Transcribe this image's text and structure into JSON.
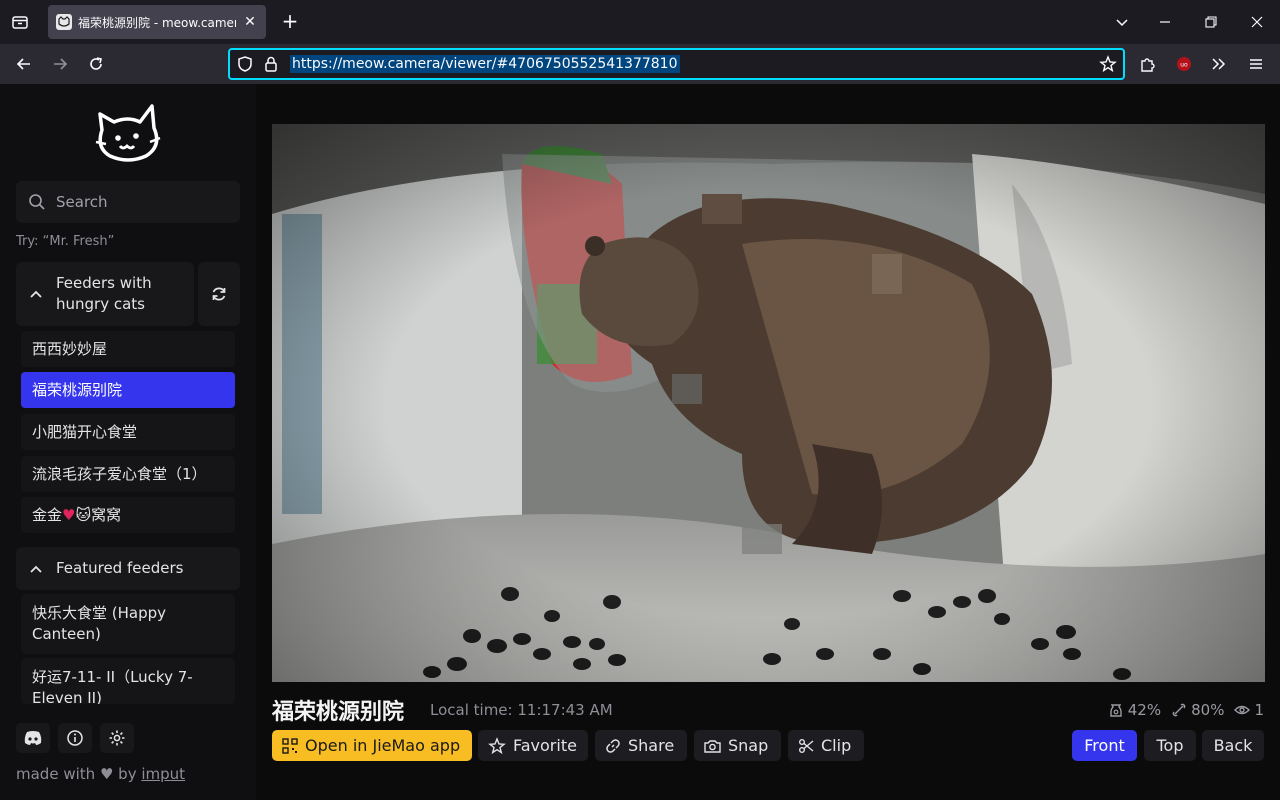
{
  "browser": {
    "tab_title": "福荣桃源别院 - meow.camera",
    "url": "https://meow.camera/viewer/#4706750552541377810"
  },
  "sidebar": {
    "search_placeholder": "Search",
    "hint": "Try: “Mr. Fresh”",
    "hungry_section": {
      "title": "Feeders with hungry cats",
      "items": [
        {
          "label": "西西妙妙屋"
        },
        {
          "label": "福荣桃源别院"
        },
        {
          "label": "小肥猫开心食堂"
        },
        {
          "label": "流浪毛孩子爱心食堂（1）"
        },
        {
          "label_prefix": "金金",
          "label_mid": "🐱",
          "label_suffix": "窝窝"
        }
      ]
    },
    "featured_section": {
      "title": "Featured feeders",
      "items": [
        {
          "label": "快乐大食堂 (Happy Canteen)"
        },
        {
          "label": "好运7-11- II（Lucky 7-Eleven II)"
        }
      ]
    },
    "footer": {
      "made_with": "made with",
      "by": "by",
      "imput": "imput"
    }
  },
  "viewer": {
    "name": "福荣桃源别院",
    "local_time": "Local time: 11:17:43 AM",
    "stats": {
      "food": "42%",
      "battery": "80%",
      "viewers": "1"
    },
    "actions": {
      "open_app": "Open in JieMao app",
      "favorite": "Favorite",
      "share": "Share",
      "snap": "Snap",
      "clip": "Clip"
    },
    "views": {
      "front": "Front",
      "top": "Top",
      "back": "Back",
      "selected": "Front"
    }
  }
}
